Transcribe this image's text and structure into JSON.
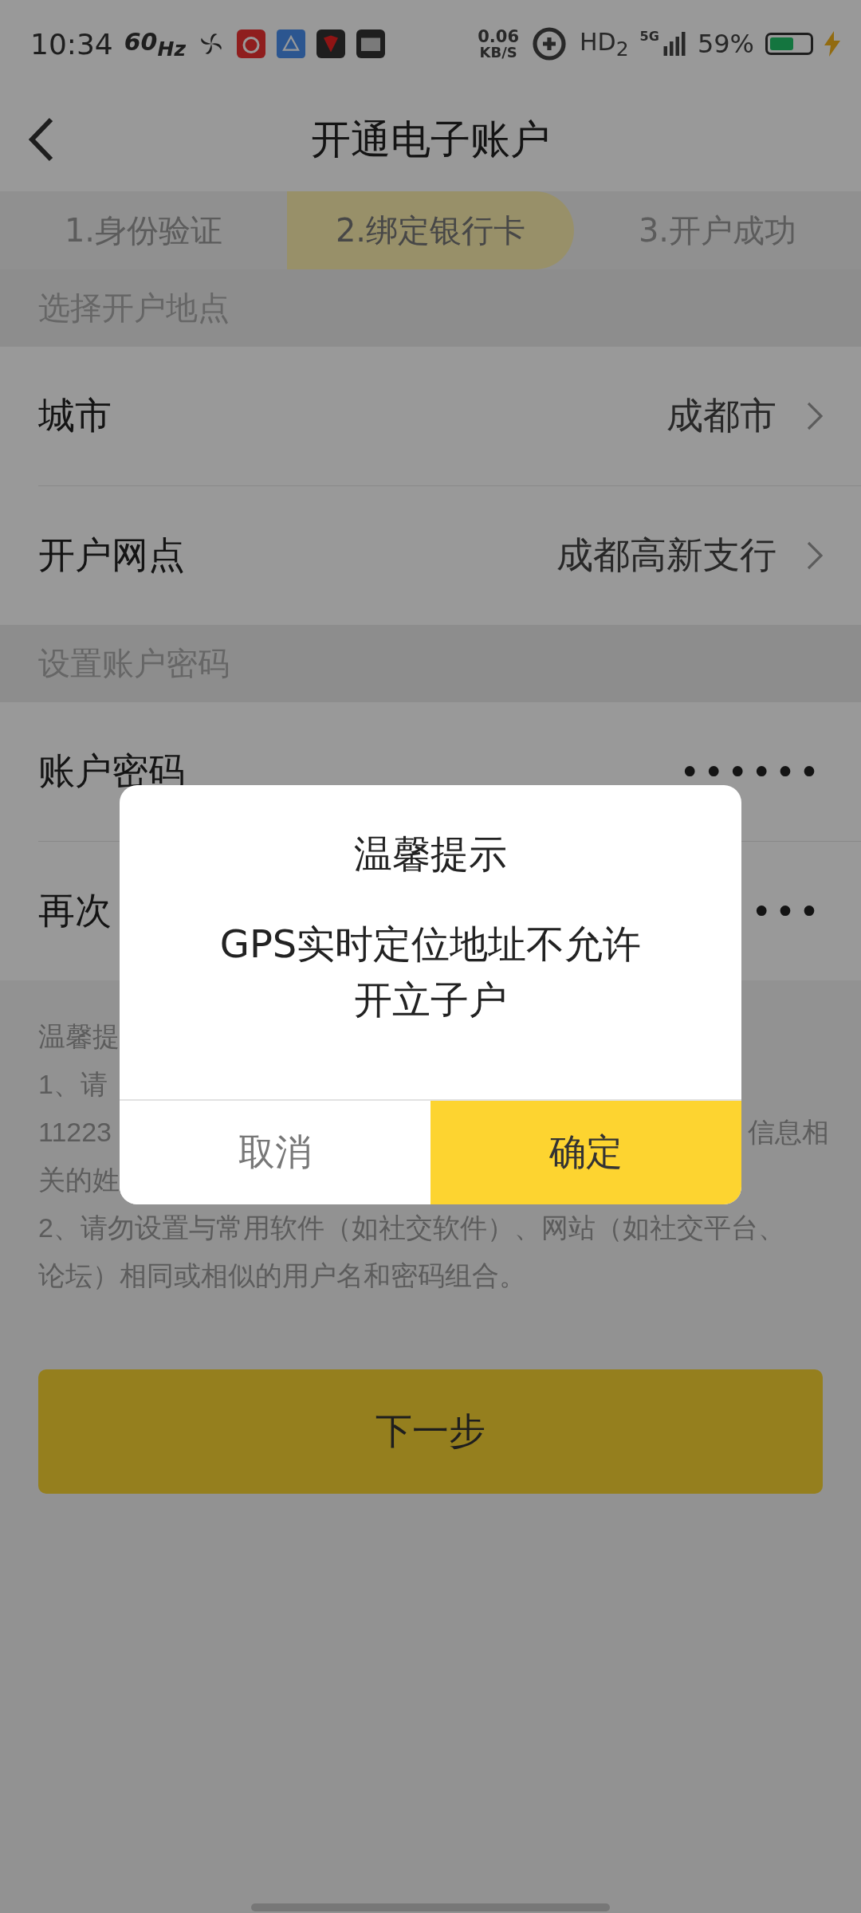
{
  "status_bar": {
    "time": "10:34",
    "refresh": "60$_{Hz}$",
    "net_speed": "0.06",
    "net_unit": "KB/S",
    "hd": "HD$_{2}$",
    "network": "5G",
    "battery": "59%",
    "level": 0.6
  },
  "header": {
    "title": "开通电子账户"
  },
  "tabs": [
    {
      "label": "1.身份验证",
      "selected": false
    },
    {
      "label": "2.绑定银行卡",
      "selected": true
    },
    {
      "label": "3.开户成功",
      "selected": false
    }
  ],
  "sections": [
    {
      "title": "选择开户地点",
      "rows": [
        {
          "label": "城市",
          "value": "成都市",
          "kind": "link"
        },
        {
          "label": "开户网点",
          "value": "成都高新支行",
          "kind": "link"
        }
      ]
    },
    {
      "title": "设置账户密码",
      "rows": [
        {
          "label": "账户密码",
          "value": "••••••",
          "kind": "password"
        },
        {
          "label": "再次",
          "value": "•••",
          "kind": "password"
        }
      ]
    }
  ],
  "notes": [
    {
      "text": "温馨提"
    },
    {
      "text": "1、请"
    },
    {
      "text": "11223",
      "tail": "信息相"
    },
    {
      "text": "关的姓"
    },
    {
      "text": "2、请勿设置与常用软件（如社交软件）、网站（如社交平台、"
    },
    {
      "text": "论坛）相同或相似的用户名和密码组合。"
    }
  ],
  "next_button": "下一步",
  "dialog": {
    "title": "温馨提示",
    "message_lines": [
      "GPS实时定位地址不允许",
      "开立子户"
    ],
    "buttons": [
      {
        "label": "取消",
        "kind": "cancel"
      },
      {
        "label": "确定",
        "kind": "confirm"
      }
    ]
  }
}
